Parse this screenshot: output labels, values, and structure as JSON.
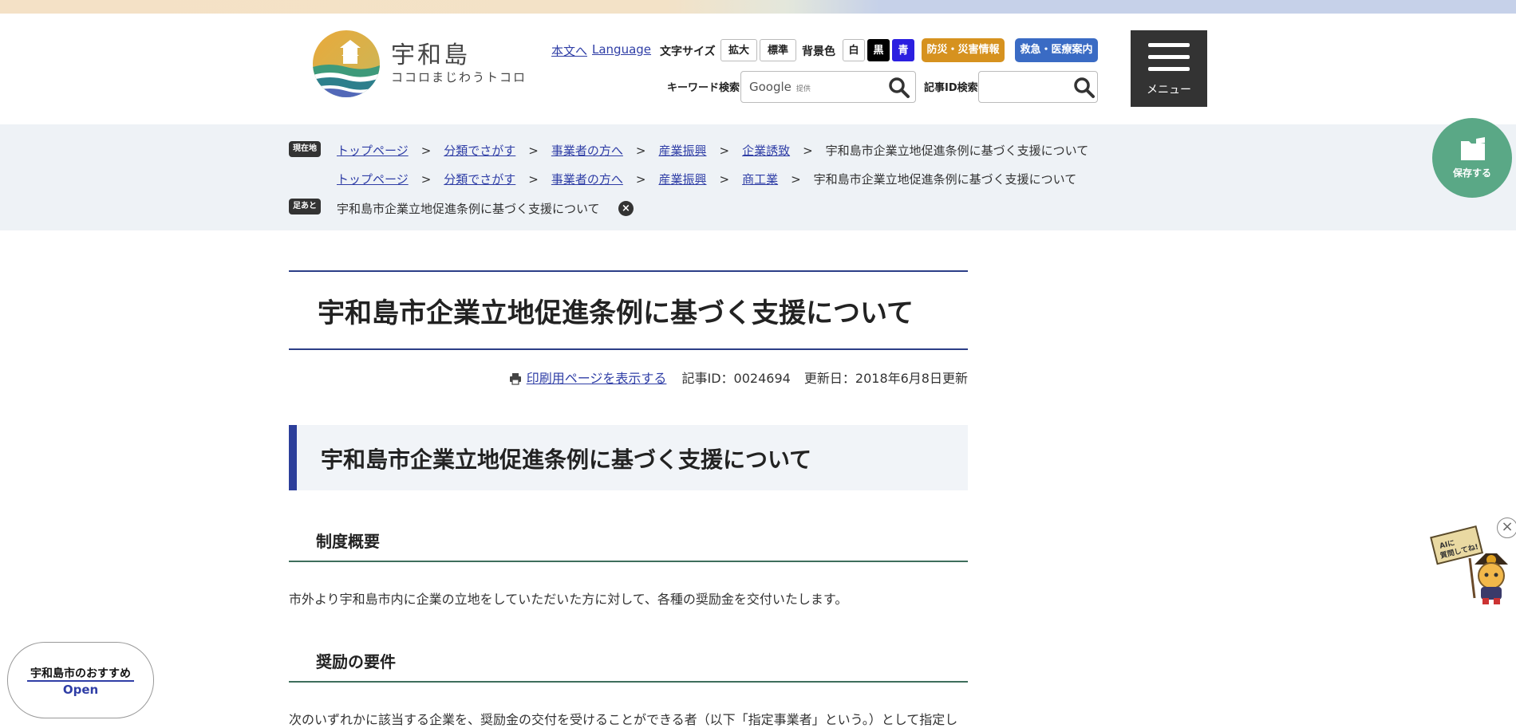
{
  "header": {
    "logo_name": "宇和島",
    "logo_subtitle": "ココロまじわうトコロ",
    "links": {
      "body": "本文へ",
      "language": "Language"
    },
    "font_size": {
      "label": "文字サイズ",
      "large": "拡大",
      "standard": "標準"
    },
    "bg_color": {
      "label": "背景色",
      "white": "白",
      "black": "黒",
      "blue": "青"
    },
    "disaster_button": "防災・災害情報",
    "emergency_button": "救急・医療案内",
    "keyword_search": {
      "label": "キーワード検索",
      "placeholder": "Google",
      "provided": "提供"
    },
    "id_search": {
      "label": "記事ID検索"
    },
    "menu_label": "メニュー",
    "colors": {
      "disaster": "#d6921f",
      "emergency": "#3a6bc4",
      "menu": "#333333",
      "blue_bg": "#2b1fe0"
    }
  },
  "breadcrumb": {
    "current_tag": "現在地",
    "trail_tag": "足あと",
    "sep": ">",
    "rows": [
      [
        "トップページ",
        "分類でさがす",
        "事業者の方へ",
        "産業振興",
        "企業誘致"
      ],
      [
        "トップページ",
        "分類でさがす",
        "事業者の方へ",
        "産業振興",
        "商工業"
      ]
    ],
    "current_page": "宇和島市企業立地促進条例に基づく支援について",
    "trail_item": "宇和島市企業立地促進条例に基づく支援について",
    "save_label": "保存する"
  },
  "main": {
    "title": "宇和島市企業立地促進条例に基づく支援について",
    "print_link": "印刷用ページを表示する",
    "article_id": "記事ID：0024694",
    "updated": "更新日：2018年6月8日更新",
    "heading2": "宇和島市企業立地促進条例に基づく支援について",
    "section1_title": "制度概要",
    "section1_text": "市外より宇和島市内に企業の立地をしていただいた方に対して、各種の奨励金を交付いたします。",
    "section2_title": "奨励の要件",
    "section2_text": "次のいずれかに該当する企業を、奨励金の交付を受けることができる者（以下「指定事業者」という。）として指定し"
  },
  "recommend": {
    "title": "宇和島市のおすすめ",
    "open": "Open"
  },
  "ai": {
    "bubble": "AIに質問してね!"
  }
}
